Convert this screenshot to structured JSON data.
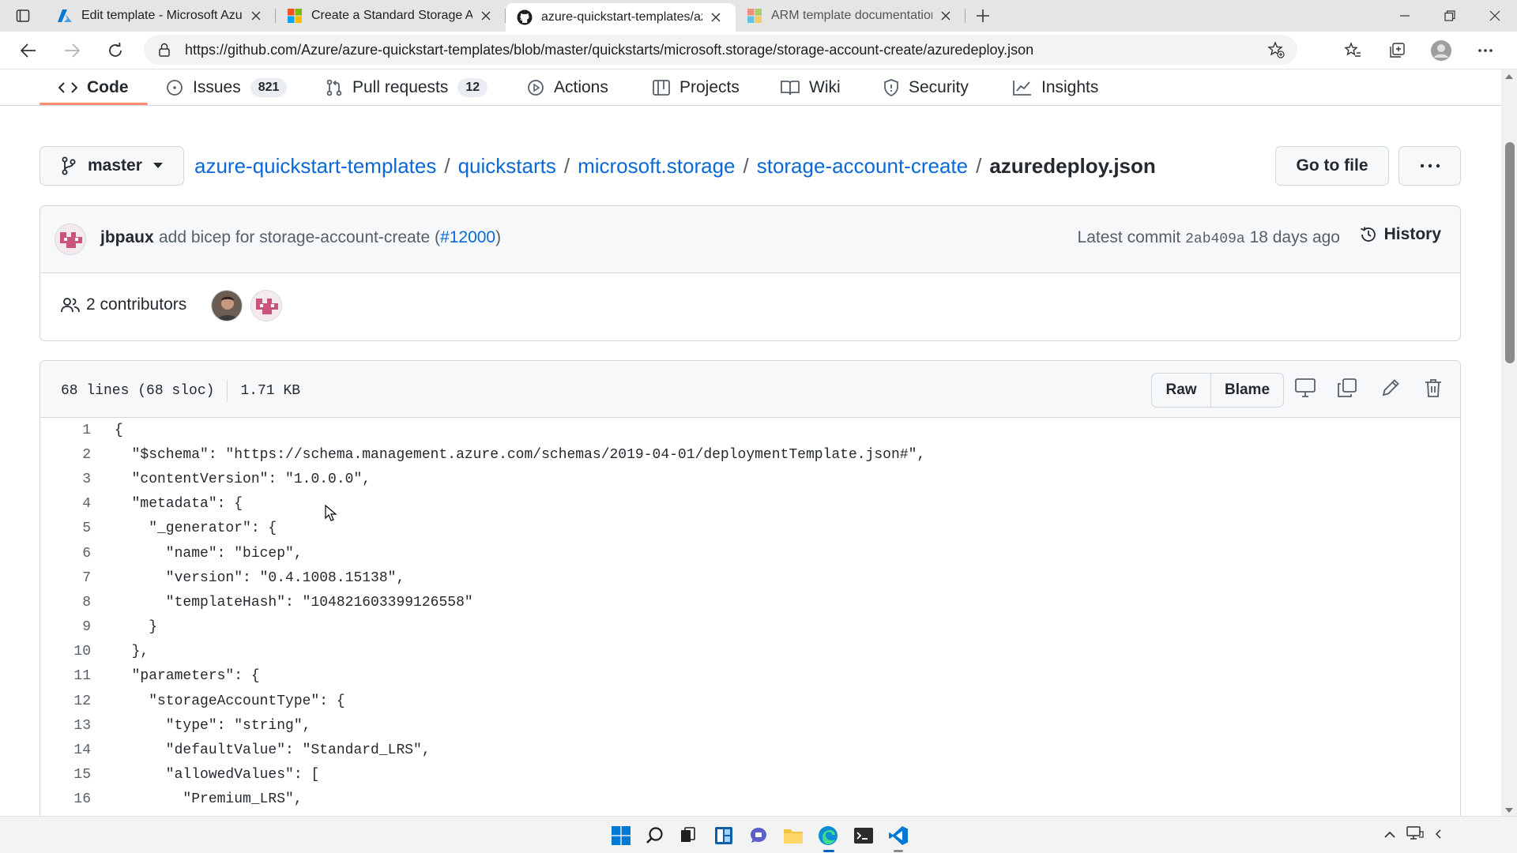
{
  "browser": {
    "tabs": [
      {
        "title": "Edit template - Microsoft Azure",
        "icon": "azure-icon",
        "active": false
      },
      {
        "title": "Create a Standard Storage Accou",
        "icon": "microsoft-icon",
        "active": false
      },
      {
        "title": "azure-quickstart-templates/azur",
        "icon": "github-icon",
        "active": true
      },
      {
        "title": "ARM template documentation | ",
        "icon": "microsoft-icon",
        "active": false
      }
    ],
    "url": "https://github.com/Azure/azure-quickstart-templates/blob/master/quickstarts/microsoft.storage/storage-account-create/azuredeploy.json"
  },
  "repo_nav": {
    "items": [
      {
        "label": "Code",
        "icon": "code-icon",
        "counter": "",
        "selected": true
      },
      {
        "label": "Issues",
        "icon": "issue-icon",
        "counter": "821",
        "selected": false
      },
      {
        "label": "Pull requests",
        "icon": "pull-request-icon",
        "counter": "12",
        "selected": false
      },
      {
        "label": "Actions",
        "icon": "play-icon",
        "counter": "",
        "selected": false
      },
      {
        "label": "Projects",
        "icon": "table-icon",
        "counter": "",
        "selected": false
      },
      {
        "label": "Wiki",
        "icon": "book-icon",
        "counter": "",
        "selected": false
      },
      {
        "label": "Security",
        "icon": "shield-icon",
        "counter": "",
        "selected": false
      },
      {
        "label": "Insights",
        "icon": "graph-icon",
        "counter": "",
        "selected": false
      }
    ]
  },
  "breadcrumb": {
    "branch": "master",
    "parts": [
      "azure-quickstart-templates",
      "quickstarts",
      "microsoft.storage",
      "storage-account-create"
    ],
    "separator": "/",
    "file": "azuredeploy.json",
    "goto_label": "Go to file",
    "more_label": "···"
  },
  "commit": {
    "author": "jbpaux",
    "message": "add bicep for storage-account-create (",
    "pr": "#12000",
    "message_end": ")",
    "latest_label": "Latest commit",
    "sha": "2ab409a",
    "age": "18 days ago",
    "history_label": "History",
    "contributors_count": "2",
    "contributors_label": "contributors"
  },
  "file": {
    "lines_info": "68 lines (68 sloc)",
    "size": "1.71 KB",
    "raw_label": "Raw",
    "blame_label": "Blame",
    "code_lines": [
      {
        "n": "1",
        "text": "{"
      },
      {
        "n": "2",
        "text": "  \"$schema\": \"https://schema.management.azure.com/schemas/2019-04-01/deploymentTemplate.json#\","
      },
      {
        "n": "3",
        "text": "  \"contentVersion\": \"1.0.0.0\","
      },
      {
        "n": "4",
        "text": "  \"metadata\": {"
      },
      {
        "n": "5",
        "text": "    \"_generator\": {"
      },
      {
        "n": "6",
        "text": "      \"name\": \"bicep\","
      },
      {
        "n": "7",
        "text": "      \"version\": \"0.4.1008.15138\","
      },
      {
        "n": "8",
        "text": "      \"templateHash\": \"104821603399126558\""
      },
      {
        "n": "9",
        "text": "    }"
      },
      {
        "n": "10",
        "text": "  },"
      },
      {
        "n": "11",
        "text": "  \"parameters\": {"
      },
      {
        "n": "12",
        "text": "    \"storageAccountType\": {"
      },
      {
        "n": "13",
        "text": "      \"type\": \"string\","
      },
      {
        "n": "14",
        "text": "      \"defaultValue\": \"Standard_LRS\","
      },
      {
        "n": "15",
        "text": "      \"allowedValues\": ["
      },
      {
        "n": "16",
        "text": "        \"Premium_LRS\","
      }
    ]
  },
  "colors": {
    "link": "#0969da",
    "accent_underline": "#fd8c73",
    "border": "#d0d7de",
    "muted": "#57606a"
  }
}
